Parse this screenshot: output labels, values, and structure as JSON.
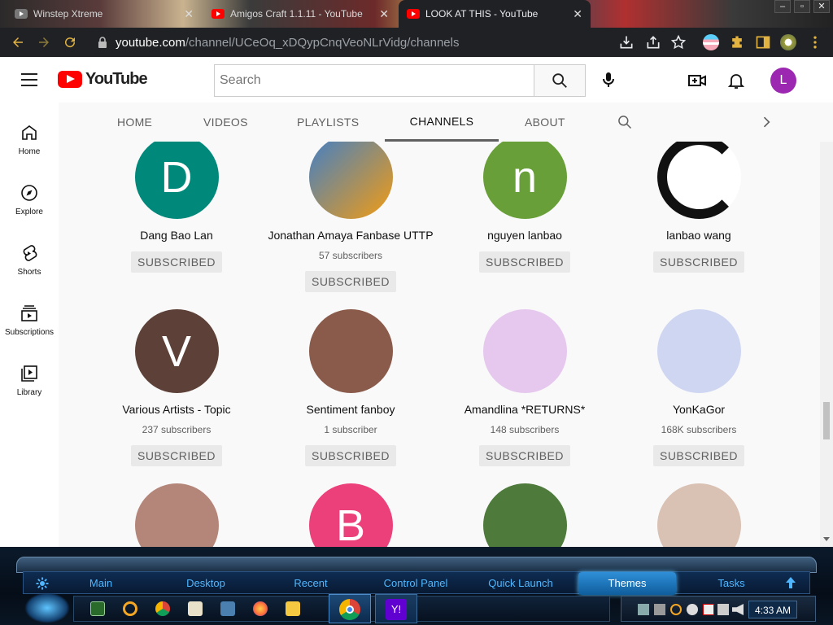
{
  "browser": {
    "tabs": [
      {
        "title": "Winstep Xtreme",
        "favicon": "gray"
      },
      {
        "title": "Amigos Craft 1.1.11 - YouTube",
        "favicon": "youtube"
      },
      {
        "title": "LOOK AT THIS - YouTube",
        "favicon": "youtube",
        "active": true
      }
    ],
    "close_glyph": "✕",
    "url_host": "youtube.com",
    "url_path": "/channel/UCeOq_xDQypCnqVeoNLrVidg/channels"
  },
  "youtube": {
    "logo_text": "YouTube",
    "search_placeholder": "Search",
    "avatar_letter": "L",
    "avatar_color": "#9c27b0",
    "sidebar": [
      {
        "label": "Home",
        "icon": "home-icon"
      },
      {
        "label": "Explore",
        "icon": "compass-icon"
      },
      {
        "label": "Shorts",
        "icon": "shorts-icon"
      },
      {
        "label": "Subscriptions",
        "icon": "subscriptions-icon"
      },
      {
        "label": "Library",
        "icon": "library-icon"
      }
    ],
    "channel_tabs": [
      "HOME",
      "VIDEOS",
      "PLAYLISTS",
      "CHANNELS",
      "ABOUT"
    ],
    "active_tab": "CHANNELS",
    "channels": [
      {
        "name": "Dang Bao Lan",
        "subs": "",
        "button": "SUBSCRIBED",
        "letter": "D",
        "color": "#00897b"
      },
      {
        "name": "Jonathan Amaya Fanbase UTTP",
        "subs": "57 subscribers",
        "button": "SUBSCRIBED",
        "letter": "",
        "color": "#3f7fc8"
      },
      {
        "name": "nguyen lanbao",
        "subs": "",
        "button": "SUBSCRIBED",
        "letter": "n",
        "color": "#689f38"
      },
      {
        "name": "lanbao wang",
        "subs": "",
        "button": "SUBSCRIBED",
        "letter": "",
        "color": "#ffffff"
      },
      {
        "name": "Various Artists - Topic",
        "subs": "237 subscribers",
        "button": "SUBSCRIBED",
        "letter": "V",
        "color": "#5d4037"
      },
      {
        "name": "Sentiment fanboy",
        "subs": "1 subscriber",
        "button": "SUBSCRIBED",
        "letter": "",
        "color": "#8a5a4a"
      },
      {
        "name": "Amandlina *RETURNS*",
        "subs": "148 subscribers",
        "button": "SUBSCRIBED",
        "letter": "",
        "color": "#e6c8ef"
      },
      {
        "name": "YonKaGor",
        "subs": "168K subscribers",
        "button": "SUBSCRIBED",
        "letter": "",
        "color": "#cfd6f2"
      },
      {
        "name": "",
        "subs": "",
        "button": "",
        "letter": "",
        "color": "#b4867a"
      },
      {
        "name": "",
        "subs": "",
        "button": "",
        "letter": "B",
        "color": "#ec407a"
      },
      {
        "name": "",
        "subs": "",
        "button": "",
        "letter": "",
        "color": "#4e7a3c"
      },
      {
        "name": "",
        "subs": "",
        "button": "",
        "letter": "",
        "color": "#d9c1b3"
      }
    ]
  },
  "taskbar": {
    "menu": [
      "Main",
      "Desktop",
      "Recent",
      "Control Panel",
      "Quick Launch",
      "Themes",
      "Tasks"
    ],
    "active_menu": "Themes",
    "clock": "4:33 AM"
  }
}
